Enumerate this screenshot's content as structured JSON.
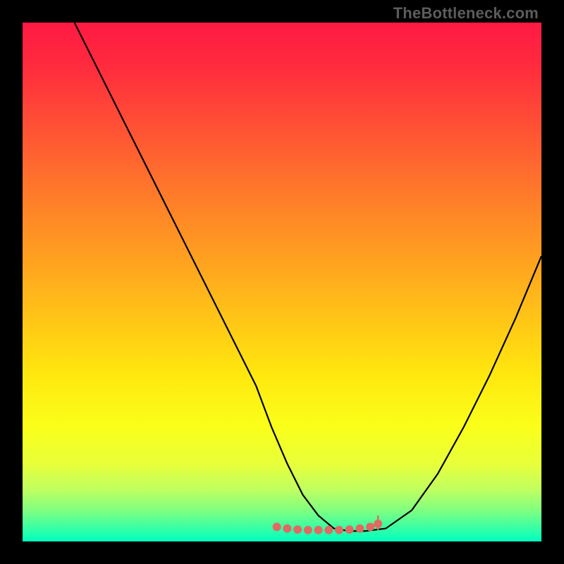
{
  "watermark": "TheBottleneck.com",
  "chart_data": {
    "type": "line",
    "title": "",
    "xlabel": "",
    "ylabel": "",
    "xlim": [
      0,
      100
    ],
    "ylim": [
      0,
      100
    ],
    "series": [
      {
        "name": "curve",
        "x": [
          10,
          15,
          20,
          25,
          30,
          35,
          40,
          45,
          48,
          51,
          54,
          57,
          60,
          63,
          66,
          70,
          75,
          80,
          85,
          90,
          95,
          100
        ],
        "y": [
          100,
          90,
          80,
          70,
          60,
          50,
          40,
          30,
          22,
          15,
          9,
          5,
          2.5,
          2,
          2,
          2.5,
          6,
          13,
          22,
          32,
          43,
          55
        ]
      }
    ],
    "markers": {
      "name": "bottom-dots",
      "x": [
        49,
        51,
        53,
        55,
        57,
        59,
        61,
        63,
        65,
        67,
        68.5
      ],
      "y": [
        2.8,
        2.5,
        2.3,
        2.2,
        2.2,
        2.2,
        2.2,
        2.3,
        2.5,
        2.8,
        3.4
      ],
      "color": "#e06a62",
      "radius": 6
    },
    "tick_marker": {
      "x": 68.5,
      "y_bottom": 2.2,
      "y_top": 5.0,
      "color": "#e06a62"
    }
  }
}
